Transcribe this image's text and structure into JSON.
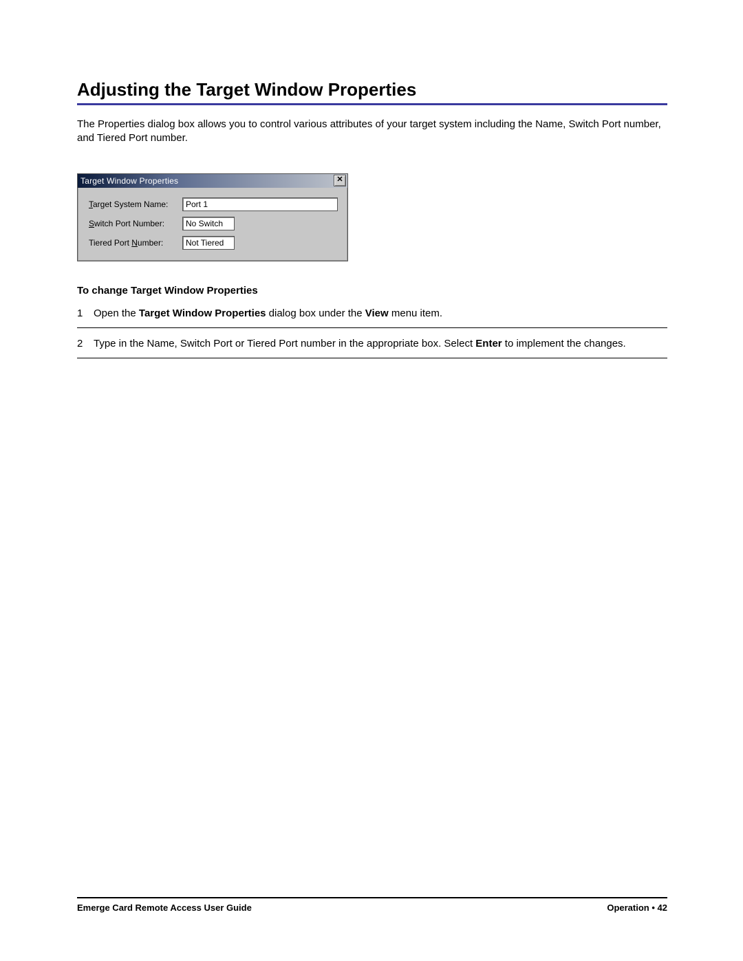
{
  "heading": "Adjusting the Target Window Properties",
  "intro": "The Properties dialog box allows you to control various attributes of your target system including the Name, Switch Port number, and Tiered Port number.",
  "dialog": {
    "title": "Target Window Properties",
    "close_glyph": "✕",
    "rows": {
      "target_name": {
        "label_pre": "T",
        "label_ul": "",
        "label_rest": "arget System Name:",
        "underline_char": "T",
        "value": "Port 1"
      },
      "switch_port": {
        "underline_char": "S",
        "label_rest": "witch Port Number:",
        "value": "No Switch"
      },
      "tiered_port": {
        "label_pre": "Tiered Port ",
        "underline_char": "N",
        "label_rest": "umber:",
        "value": "Not Tiered"
      }
    }
  },
  "subheading": "To change Target Window Properties",
  "steps": [
    {
      "num": "1",
      "pre": "Open the ",
      "b1": "Target Window Properties",
      "mid": " dialog box under the ",
      "b2": "View",
      "post": " menu item."
    },
    {
      "num": "2",
      "pre": "Type in the Name, Switch Port or Tiered Port number in the appropriate box. Select ",
      "b1": "Enter",
      "mid": " to implement the changes.",
      "b2": "",
      "post": ""
    }
  ],
  "footer": {
    "left": "Emerge Card Remote Access User Guide",
    "right_label": "Operation",
    "bullet": " • ",
    "page": "42"
  }
}
